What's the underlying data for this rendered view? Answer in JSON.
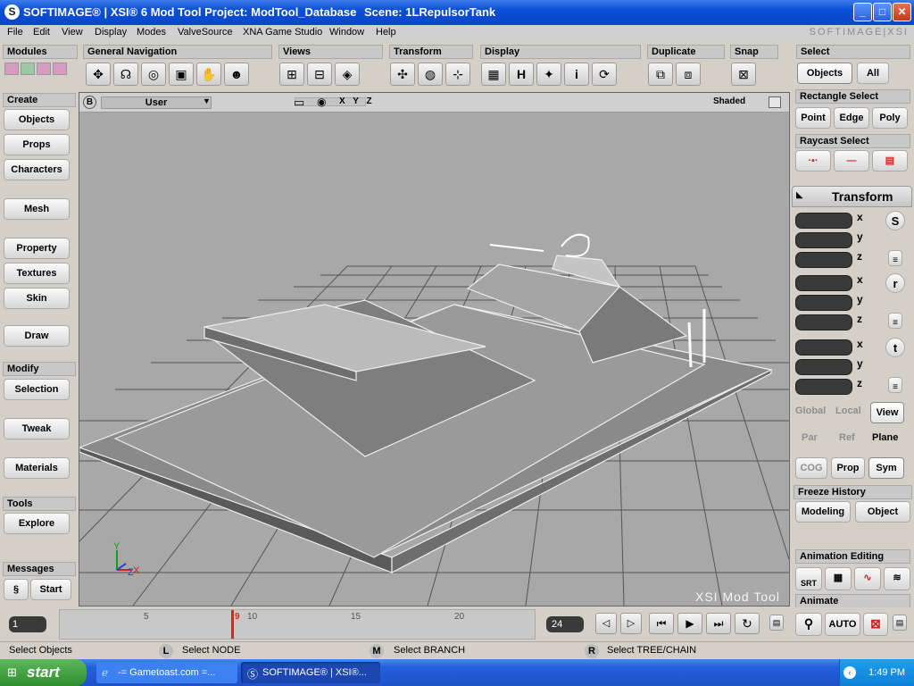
{
  "title": {
    "app": "SOFTIMAGE® | XSI® 6 Mod Tool Project: ModTool_Database",
    "scene": "Scene: 1LRepulsorTank"
  },
  "window_controls": {
    "minimize": "_",
    "maximize": "□",
    "close": "✕"
  },
  "menu": {
    "items": [
      "File",
      "Edit",
      "View",
      "Display",
      "Modes",
      "ValveSource",
      "XNA Game Studio",
      "Window",
      "Help"
    ],
    "brand": "SOFTIMAGE|XSI"
  },
  "toolbar": {
    "modules": "Modules",
    "general_navigation": "General Navigation",
    "views": "Views",
    "transform": "Transform",
    "display": "Display",
    "display_h": "H",
    "display_i": "i",
    "duplicate": "Duplicate",
    "snap": "Snap"
  },
  "select_panel": {
    "header": "Select",
    "objects": "Objects",
    "all": "All"
  },
  "left_panel": {
    "create": "Create",
    "objects": "Objects",
    "props": "Props",
    "characters": "Characters",
    "mesh": "Mesh",
    "property": "Property",
    "textures": "Textures",
    "skin": "Skin",
    "draw": "Draw",
    "modify": "Modify",
    "selection": "Selection",
    "tweak": "Tweak",
    "materials": "Materials",
    "tools": "Tools",
    "explore": "Explore",
    "messages": "Messages",
    "start": "Start"
  },
  "viewport": {
    "b": "B",
    "camera": "User",
    "xyz": "X Y Z",
    "mode": "Shaded",
    "watermark": "XSI Mod Tool"
  },
  "right_panel": {
    "rect_select": "Rectangle Select",
    "point": "Point",
    "edge": "Edge",
    "poly": "Poly",
    "raycast_select": "Raycast Select",
    "transform": "Transform",
    "x": "x",
    "y": "y",
    "z": "z",
    "s": "S",
    "r": "r",
    "t": "t",
    "global": "Global",
    "local": "Local",
    "view": "View",
    "par": "Par",
    "ref": "Ref",
    "plane": "Plane",
    "cog": "COG",
    "prop": "Prop",
    "sym": "Sym",
    "freeze_history": "Freeze History",
    "modeling": "Modeling",
    "object": "Object",
    "anim_editing": "Animation Editing",
    "srt": "SRT",
    "animate": "Animate",
    "auto": "AUTO"
  },
  "timeline": {
    "current_frame": "1",
    "end_frame": "24",
    "ticks": [
      "5",
      "10",
      "15",
      "20"
    ],
    "playhead": "9",
    "playhead_frac": 0.36
  },
  "status": {
    "select_objects": "Select Objects",
    "l": "L",
    "m": "M",
    "r": "R",
    "node": "Select NODE",
    "branch": "Select BRANCH",
    "tree": "Select TREE/CHAIN"
  },
  "taskbar": {
    "start": "start",
    "task1": "-= Gametoast.com =...",
    "task2": "SOFTIMAGE® | XSI®...",
    "time": "1:49 PM"
  }
}
